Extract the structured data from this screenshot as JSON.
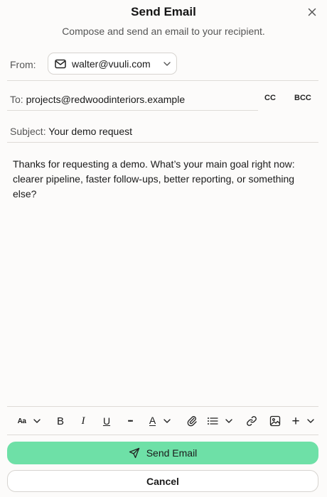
{
  "dialog": {
    "title": "Send Email",
    "subtitle": "Compose and send an email to your recipient."
  },
  "from": {
    "label": "From:",
    "value": "walter@vuuli.com"
  },
  "to": {
    "label": "To:",
    "value": "projects@redwoodinteriors.example",
    "cc_label": "CC",
    "bcc_label": "BCC"
  },
  "subject": {
    "label": "Subject:",
    "value": "Your demo request"
  },
  "body": {
    "text": "Thanks for requesting a demo. What’s your main goal right now: clearer pipeline, faster follow-ups, better reporting, or something else?"
  },
  "toolbar": {
    "font_size_glyph": "Aa",
    "bold_glyph": "B",
    "italic_glyph": "I",
    "underline_glyph": "U",
    "more_glyph": "•••",
    "text_color_glyph": "A",
    "insert_glyph": "+",
    "icons": [
      "font-size-icon",
      "bold-icon",
      "italic-icon",
      "underline-icon",
      "more-icon",
      "text-color-icon",
      "attachment-icon",
      "list-icon",
      "link-icon",
      "image-icon",
      "insert-icon"
    ]
  },
  "actions": {
    "send_label": "Send Email",
    "cancel_label": "Cancel"
  },
  "colors": {
    "send_button": "#6ee0a7",
    "background": "#fcfbfa"
  }
}
